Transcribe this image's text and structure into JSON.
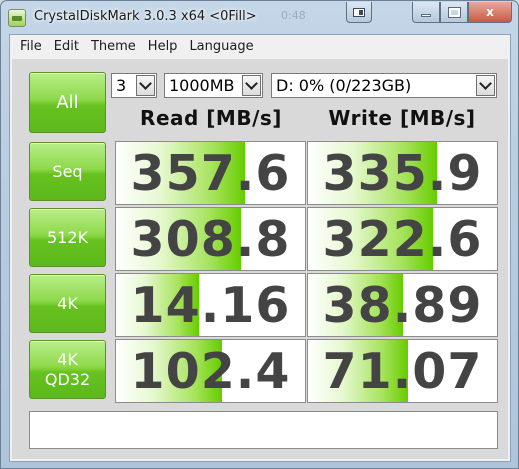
{
  "window": {
    "title": "CrystalDiskMark 3.0.3 x64 <0Fill>",
    "ghost_title": "0:48",
    "close_glyph": "x"
  },
  "menu": [
    "File",
    "Edit",
    "Theme",
    "Help",
    "Language"
  ],
  "controls": {
    "all_label": "All",
    "test_count": "3",
    "test_size": "1000MB",
    "drive": "D: 0% (0/223GB)"
  },
  "columns": {
    "read": "Read [MB/s]",
    "write": "Write [MB/s]"
  },
  "rows": [
    {
      "label": "Seq",
      "read": "357.6",
      "write": "335.9",
      "read_fill": 0.68,
      "write_fill": 0.68
    },
    {
      "label": "512K",
      "read": "308.8",
      "write": "322.6",
      "read_fill": 0.66,
      "write_fill": 0.66
    },
    {
      "label": "4K",
      "read": "14.16",
      "write": "38.89",
      "read_fill": 0.44,
      "write_fill": 0.5
    },
    {
      "label": "4K",
      "label2": "QD32",
      "read": "102.4",
      "write": "71.07",
      "read_fill": 0.56,
      "write_fill": 0.53
    }
  ],
  "comment": ""
}
